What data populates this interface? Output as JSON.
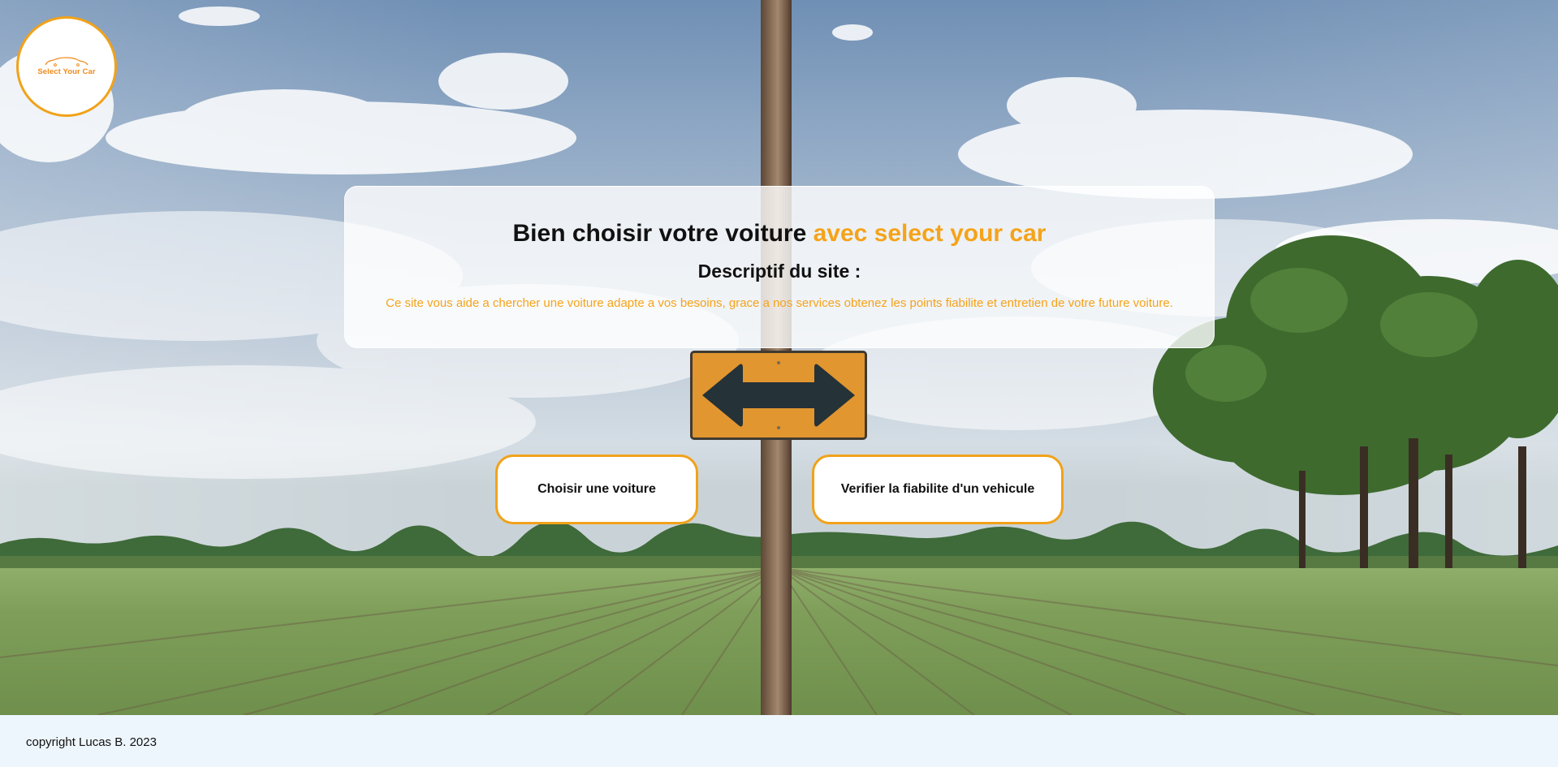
{
  "logo": {
    "text": "Select Your Car",
    "icon": "car-outline-icon",
    "color": "#f08a1c"
  },
  "hero": {
    "title_main": "Bien choisir votre voiture ",
    "title_accent": "avec select your car",
    "subtitle": "Descriptif du site :",
    "description": "Ce site vous aide a chercher une voiture adapte a vos besoins, grace a nos services obtenez les points fiabilite et entretien de votre future voiture."
  },
  "buttons": {
    "choose_label": "Choisir une voiture",
    "verify_label": "Verifier la fiabilite d'un vehicule"
  },
  "footer": {
    "copyright": "copyright Lucas B. 2023"
  },
  "colors": {
    "accent": "#f5a31a",
    "border_accent": "#f1a21a",
    "footer_bg": "#eef6fd"
  },
  "background": {
    "scene": "field-with-signpost",
    "sign_icon": "double-arrow-sign-icon"
  }
}
